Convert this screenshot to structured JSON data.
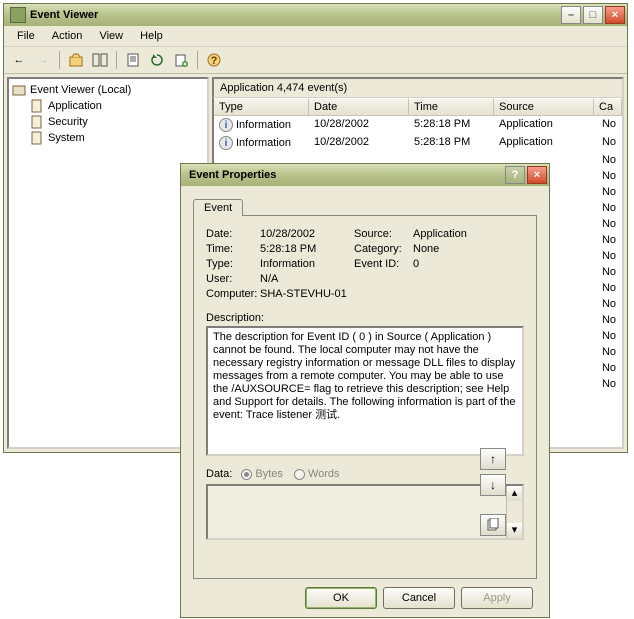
{
  "main": {
    "title": "Event Viewer",
    "menu": [
      "File",
      "Action",
      "View",
      "Help"
    ],
    "tree": {
      "root": "Event Viewer (Local)",
      "items": [
        "Application",
        "Security",
        "System"
      ]
    },
    "list": {
      "header": "Application   4,474 event(s)",
      "cols": [
        "Type",
        "Date",
        "Time",
        "Source",
        "Ca"
      ],
      "rows": [
        {
          "type": "Information",
          "date": "10/28/2002",
          "time": "5:28:18 PM",
          "src": "Application",
          "ca": "No"
        },
        {
          "type": "Information",
          "date": "10/28/2002",
          "time": "5:28:18 PM",
          "src": "Application",
          "ca": "No"
        }
      ],
      "trailing_ca": [
        "No",
        "No",
        "No",
        "No",
        "No",
        "No",
        "No",
        "No",
        "No",
        "No",
        "No",
        "No",
        "No",
        "No",
        "No"
      ]
    }
  },
  "dlg": {
    "title": "Event Properties",
    "tab": "Event",
    "kv": {
      "date_l": "Date:",
      "date_v": "10/28/2002",
      "source_l": "Source:",
      "source_v": "Application",
      "time_l": "Time:",
      "time_v": "5:28:18 PM",
      "cat_l": "Category:",
      "cat_v": "None",
      "type_l": "Type:",
      "type_v": "Information",
      "eid_l": "Event ID:",
      "eid_v": "0",
      "user_l": "User:",
      "user_v": "N/A",
      "comp_l": "Computer:",
      "comp_v": "SHA-STEVHU-01"
    },
    "desc_l": "Description:",
    "desc": "The description for Event ID ( 0 ) in Source ( Application ) cannot be found. The local computer may not have the necessary registry information or message DLL files to display messages from a remote computer. You may be able to use the /AUXSOURCE= flag to retrieve this description; see Help and Support for details. The following information is part of the event: Trace listener 测试.",
    "data_l": "Data:",
    "bytes": "Bytes",
    "words": "Words",
    "ok": "OK",
    "cancel": "Cancel",
    "apply": "Apply"
  }
}
